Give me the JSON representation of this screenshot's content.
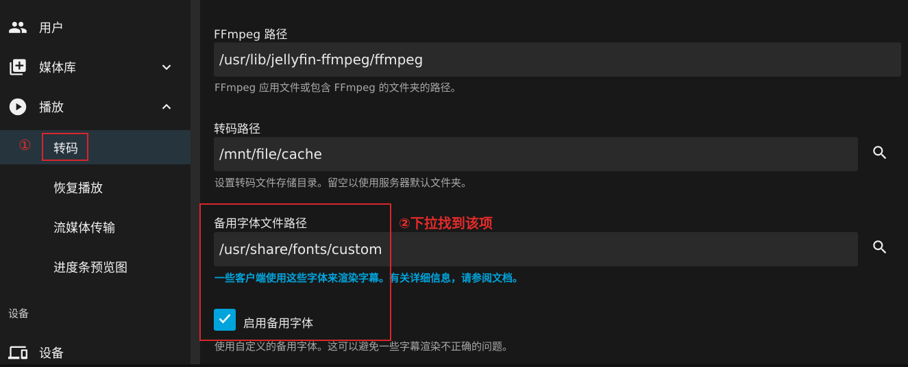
{
  "sidebar": {
    "items": [
      {
        "label": "用户",
        "icon": "users-icon"
      },
      {
        "label": "媒体库",
        "icon": "library-add-icon",
        "expanded": false
      },
      {
        "label": "播放",
        "icon": "play-circle-icon",
        "expanded": true
      }
    ],
    "sub_items": [
      {
        "label": "转码",
        "active": true
      },
      {
        "label": "恢复播放"
      },
      {
        "label": "流媒体传输"
      },
      {
        "label": "进度条预览图"
      }
    ],
    "section_header": "设备",
    "devices_item": {
      "label": "设备",
      "icon": "devices-icon"
    }
  },
  "annotations": {
    "step1": "①",
    "step2": "②下拉找到该项",
    "color": "#d9262b"
  },
  "main": {
    "ffmpeg": {
      "label": "FFmpeg 路径",
      "value": "/usr/lib/jellyfin-ffmpeg/ffmpeg",
      "help": "FFmpeg 应用文件或包含 FFmpeg 的文件夹的路径。"
    },
    "transcode": {
      "label": "转码路径",
      "value": "/mnt/file/cache",
      "help": "设置转码文件存储目录。留空以使用服务器默认文件夹。"
    },
    "fallback_font": {
      "label": "备用字体文件路径",
      "value": "/usr/share/fonts/custom",
      "help": "一些客户端使用这些字体来渲染字幕。有关详细信息，请参阅文档。"
    },
    "enable_fallback": {
      "label": "启用备用字体",
      "checked": true,
      "help": "使用自定义的备用字体。这可以避免一些字幕渲染不正确的问题。"
    }
  },
  "colors": {
    "accent": "#00a4dc",
    "annotation_red": "#e52b2b",
    "active_nav_bg": "#26343d"
  }
}
